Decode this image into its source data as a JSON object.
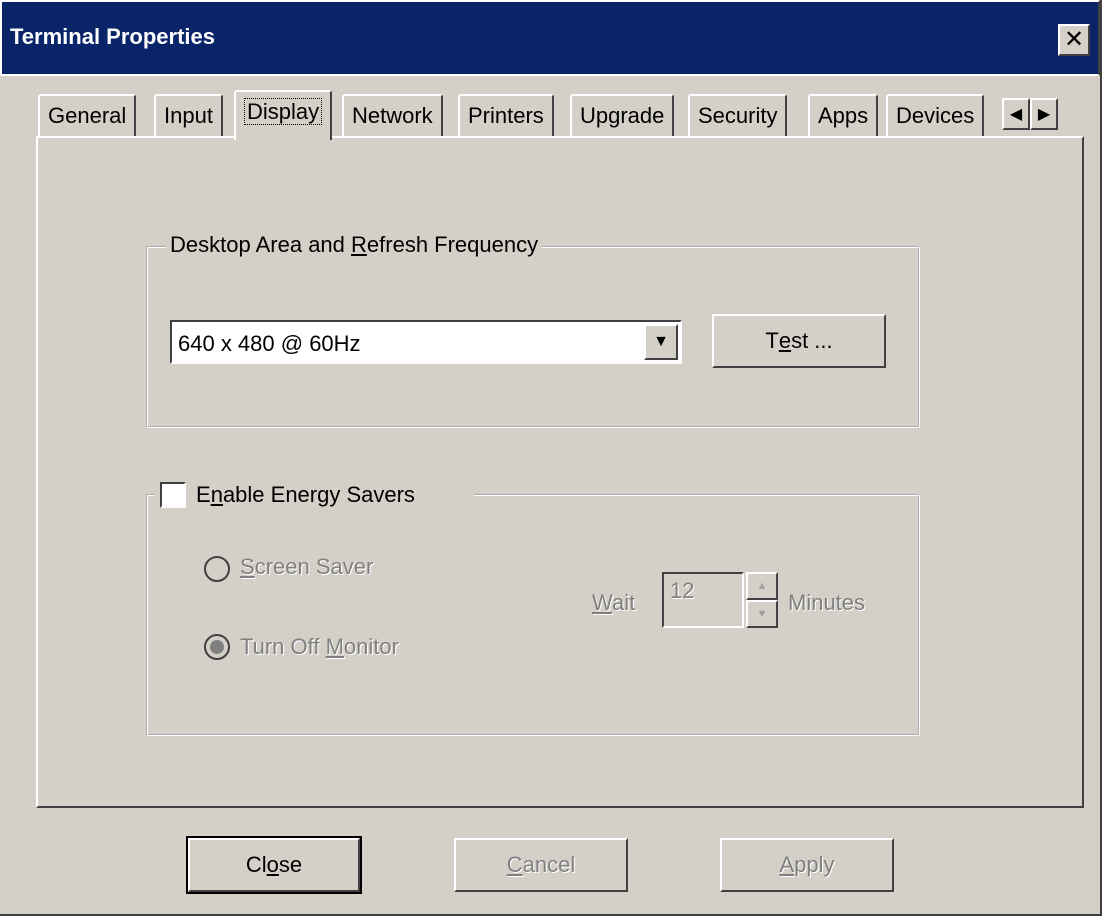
{
  "window": {
    "title": "Terminal Properties",
    "close_glyph": "✕"
  },
  "tabs": [
    {
      "label": "General",
      "active": false
    },
    {
      "label": "Input",
      "active": false
    },
    {
      "label": "Display",
      "active": true
    },
    {
      "label": "Network",
      "active": false
    },
    {
      "label": "Printers",
      "active": false
    },
    {
      "label": "Upgrade",
      "active": false
    },
    {
      "label": "Security",
      "active": false
    },
    {
      "label": "Apps",
      "active": false
    },
    {
      "label": "Devices",
      "active": false
    }
  ],
  "tab_scroll": {
    "left_icon": "◀",
    "right_icon": "▶"
  },
  "desktop_area": {
    "legend_pre": "Desktop Area and ",
    "legend_accel": "R",
    "legend_post": "efresh Frequency",
    "resolution_value": "640 x 480 @ 60Hz",
    "dropdown_icon": "▼",
    "test_pre": "T",
    "test_accel": "e",
    "test_post": "st ..."
  },
  "energy": {
    "checkbox_checked": false,
    "label_pre": "E",
    "label_accel": "n",
    "label_post": "able Energy Savers",
    "screen_saver_accel": "S",
    "screen_saver_post": "creen Saver",
    "screen_saver_selected": false,
    "monitor_pre": "Turn Off ",
    "monitor_accel": "M",
    "monitor_post": "onitor",
    "monitor_selected": true,
    "wait_accel": "W",
    "wait_post": "ait",
    "wait_value": "12",
    "minutes_label": "Minutes",
    "spin_up_icon": "▲",
    "spin_down_icon": "▼"
  },
  "buttons": {
    "close_pre": "Cl",
    "close_accel": "o",
    "close_post": "se",
    "cancel_accel": "C",
    "cancel_post": "ancel",
    "apply_accel": "A",
    "apply_post": "pply"
  }
}
